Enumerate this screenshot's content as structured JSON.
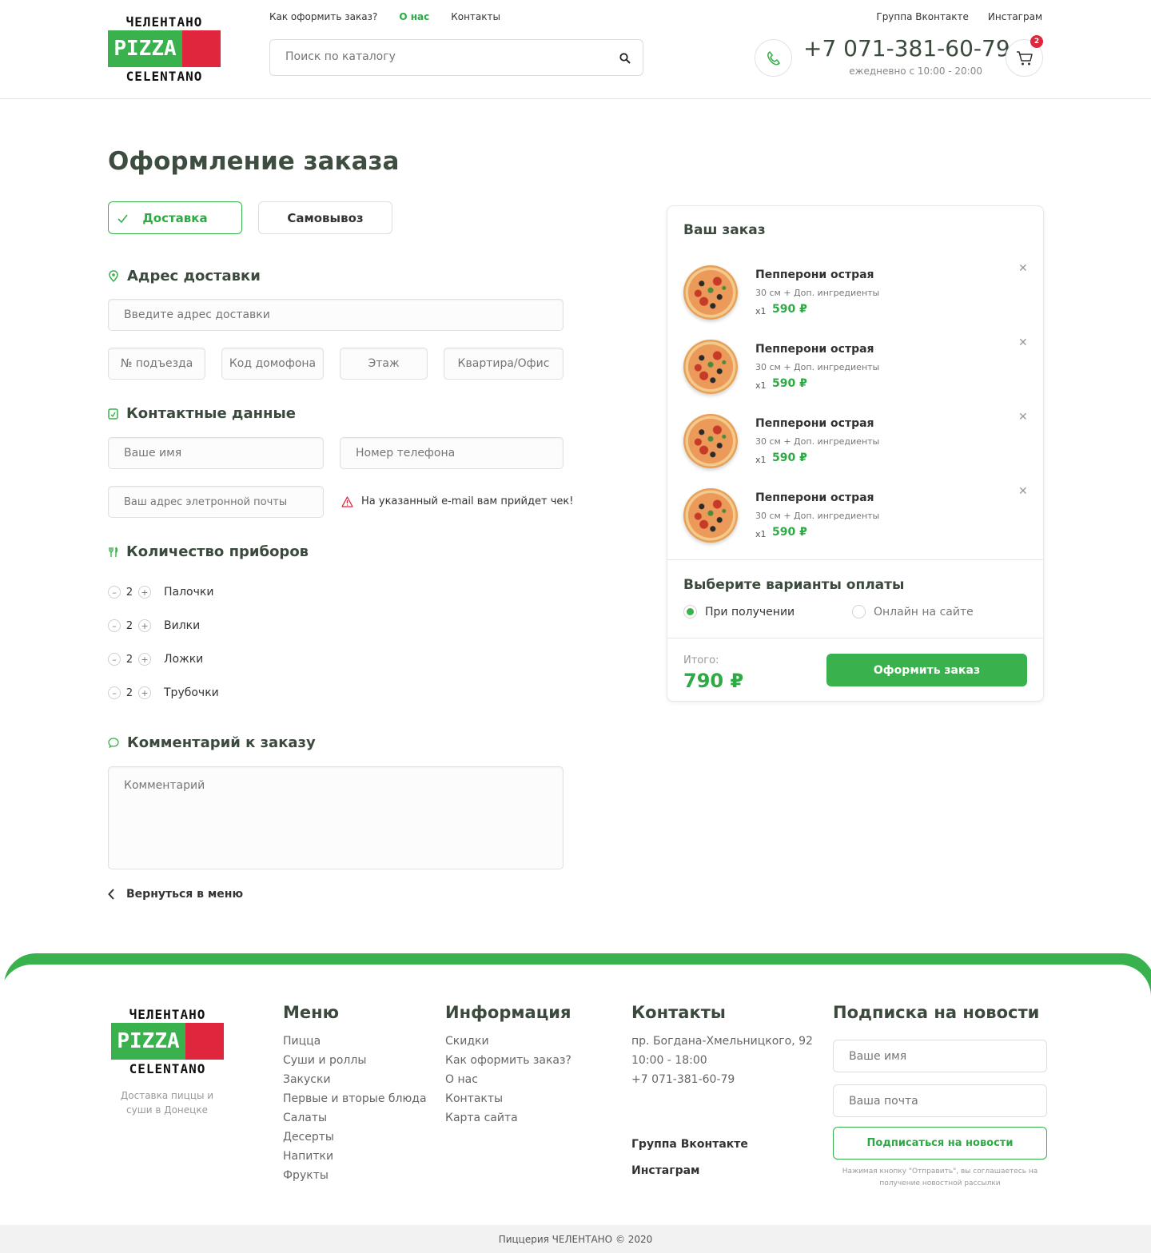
{
  "header": {
    "logo_top": "ЧЕЛЕНТАНО",
    "logo_mid": "PIZZA",
    "logo_bot": "CELENTANO",
    "nav": [
      "Как оформить заказ?",
      "О нас",
      "Контакты"
    ],
    "social": [
      "Группа Вконтакте",
      "Инстаграм"
    ],
    "search_placeholder": "Поиск по каталогу",
    "phone": "+7 071-381-60-79",
    "hours": "ежедневно с 10:00 - 20:00",
    "cart_count": "2"
  },
  "main": {
    "title": "Оформление заказа",
    "tabs": [
      "Доставка",
      "Самовывоз"
    ],
    "address_title": "Адрес доставки",
    "address_placeholder": "Введите адрес доставки",
    "address_fields": [
      "№ подъезда",
      "Код домофона",
      "Этаж",
      "Квартира/Офис"
    ],
    "contact_title": "Контактные данные",
    "name_placeholder": "Ваше имя",
    "phone_placeholder": "Номер телефона",
    "email_placeholder": "Ваш адрес элетронной почты",
    "email_note": "На указанный e-mail вам прийдет чек!",
    "cutlery_title": "Количество приборов",
    "cutlery": [
      {
        "label": "Палочки",
        "qty": "2"
      },
      {
        "label": "Вилки",
        "qty": "2"
      },
      {
        "label": "Ложки",
        "qty": "2"
      },
      {
        "label": "Трубочки",
        "qty": "2"
      }
    ],
    "comment_title": "Комментарий к заказу",
    "comment_placeholder": "Комментарий",
    "back_label": "Вернуться в меню"
  },
  "order": {
    "title": "Ваш заказ",
    "items": [
      {
        "name": "Пепперони острая",
        "desc": "30 см + Доп. ингредиенты",
        "qty": "x1",
        "price": "590 ₽"
      },
      {
        "name": "Пепперони острая",
        "desc": "30 см + Доп. ингредиенты",
        "qty": "x1",
        "price": "590 ₽"
      },
      {
        "name": "Пепперони острая",
        "desc": "30 см + Доп. ингредиенты",
        "qty": "x1",
        "price": "590 ₽"
      },
      {
        "name": "Пепперони острая",
        "desc": "30 см + Доп. ингредиенты",
        "qty": "x1",
        "price": "590 ₽"
      }
    ],
    "payment_title": "Выберите варианты оплаты",
    "payment_options": [
      "При получении",
      "Онлайн на сайте"
    ],
    "total_label": "Итого:",
    "total_value": "790 ₽",
    "submit_label": "Оформить заказ"
  },
  "footer": {
    "tagline": "Доставка пиццы и суши в Донецке",
    "menu_title": "Меню",
    "menu_links": [
      "Пицца",
      "Суши и роллы",
      "Закуски",
      "Первые и вторые блюда",
      "Салаты",
      "Десерты",
      "Напитки",
      "Фрукты"
    ],
    "info_title": "Информация",
    "info_links": [
      "Скидки",
      "Как оформить заказ?",
      "О нас",
      "Контакты",
      "Карта сайта"
    ],
    "contacts_title": "Контакты",
    "address": "пр. Богдана-Хмельницкого, 92",
    "hours": "10:00 - 18:00",
    "phone": "+7 071-381-60-79",
    "vk": "Группа Вконтакте",
    "instagram": "Инстаграм",
    "subscribe_title": "Подписка на новости",
    "sub_name_placeholder": "Ваше имя",
    "sub_email_placeholder": "Ваша почта",
    "subscribe_button": "Подписаться на новости",
    "subscribe_note": "Нажимая кнопку \"Отправить\", вы соглашаетесь на получение новостной рассылки",
    "copyright": "Пиццерия ЧЕЛЕНТАНО © 2020"
  },
  "colors": {
    "accent": "#39b14c",
    "badge": "#e0263c",
    "logo_red": "#e0263c"
  }
}
